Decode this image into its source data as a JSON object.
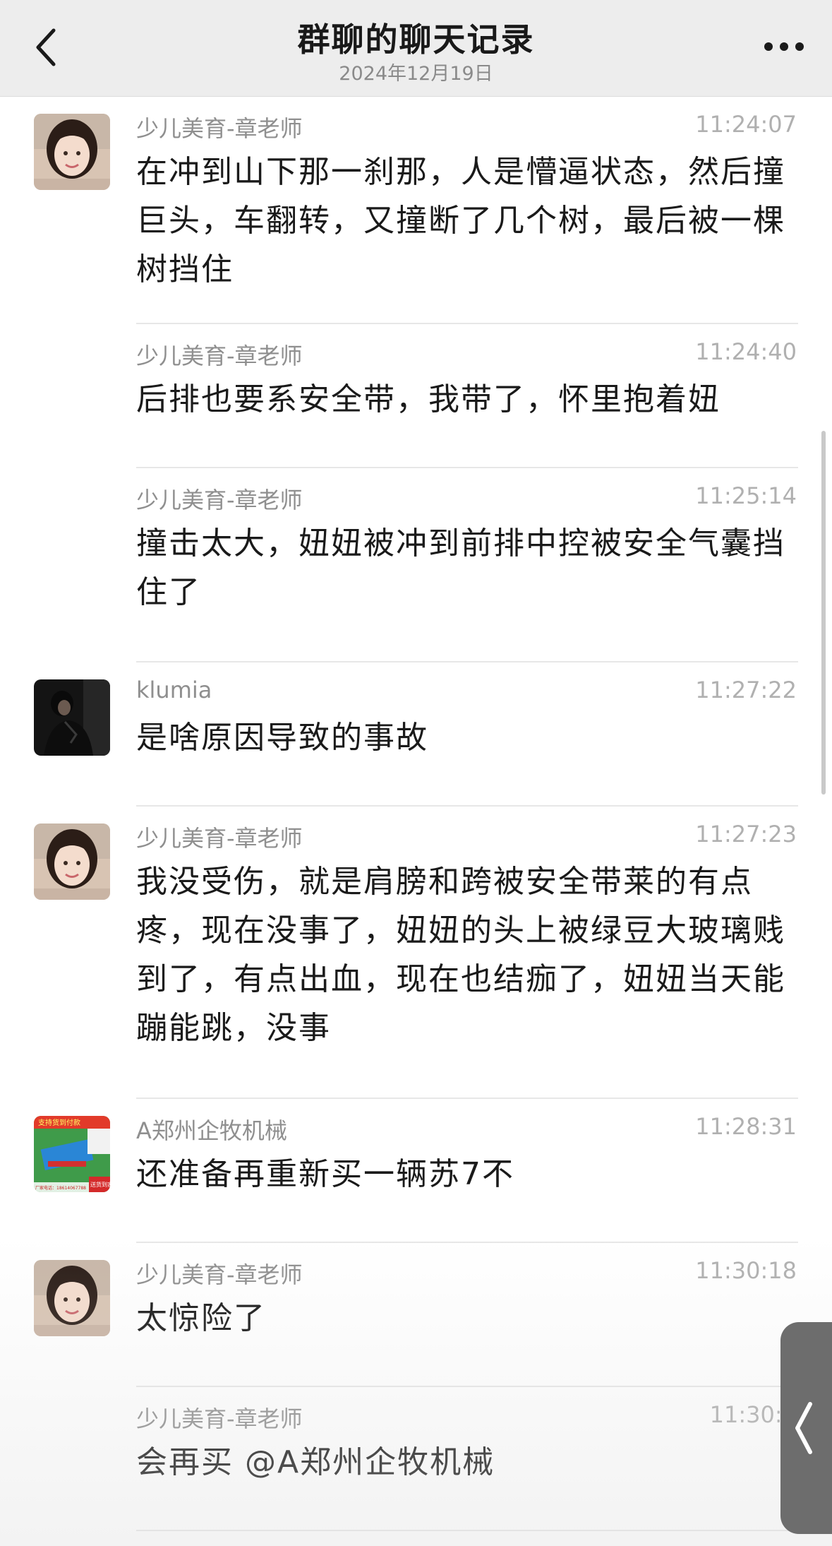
{
  "header": {
    "title": "群聊的聊天记录",
    "date": "2024年12月19日"
  },
  "messages": [
    {
      "sender": "少儿美育-章老师",
      "time": "11:24:07",
      "text": "在冲到山下那一刹那，人是懵逼状态，然后撞巨头，车翻转，又撞断了几个树，最后被一棵树挡住",
      "avatar": "woman-avatar"
    },
    {
      "sender": "少儿美育-章老师",
      "time": "11:24:40",
      "text": "后排也要系安全带，我带了，怀里抱着妞",
      "avatar": ""
    },
    {
      "sender": "少儿美育-章老师",
      "time": "11:25:14",
      "text": "撞击太大，妞妞被冲到前排中控被安全气囊挡住了",
      "avatar": ""
    },
    {
      "sender": "klumia",
      "time": "11:27:22",
      "text": "是啥原因导致的事故",
      "avatar": "dark-photo-avatar"
    },
    {
      "sender": "少儿美育-章老师",
      "time": "11:27:23",
      "text": "我没受伤，就是肩膀和跨被安全带莱的有点疼，现在没事了，妞妞的头上被绿豆大玻璃贱到了，有点出血，现在也结痂了，妞妞当天能蹦能跳，没事",
      "avatar": "woman-avatar"
    },
    {
      "sender": "A郑州企牧机械",
      "time": "11:28:31",
      "text": "还准备再重新买一辆苏7不",
      "avatar": "machine-ad-avatar"
    },
    {
      "sender": "少儿美育-章老师",
      "time": "11:30:18",
      "text": "太惊险了",
      "avatar": "woman-avatar"
    },
    {
      "sender": "少儿美育-章老师",
      "time": "11:30:3",
      "text": "会再买 @A郑州企牧机械",
      "avatar": ""
    }
  ],
  "ad_avatar": {
    "top_text": "支持货到付款",
    "phone_text": "厂家电话：18614067788",
    "badge_text": "送货到家"
  },
  "colors": {
    "header_bg": "#ededed",
    "text": "#1a1a1a",
    "meta": "#8f8f8f",
    "divider": "#e7e7e7"
  }
}
